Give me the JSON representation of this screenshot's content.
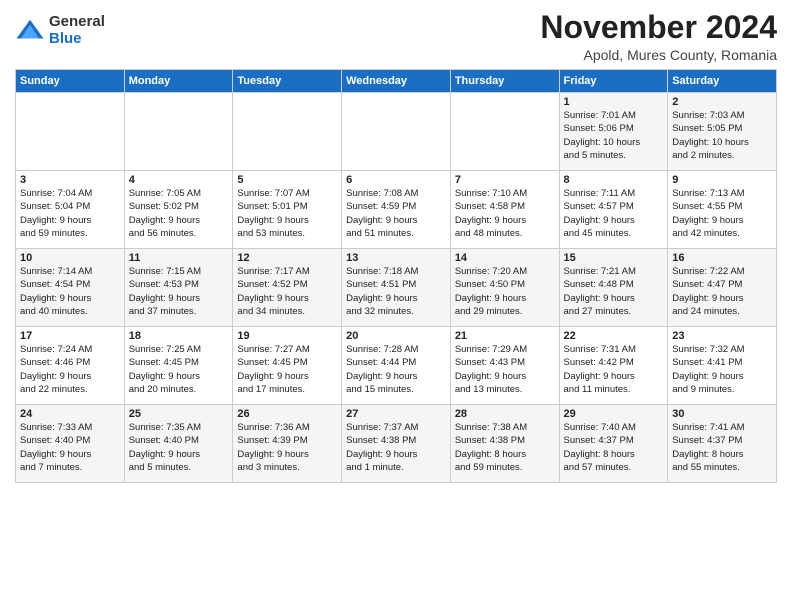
{
  "header": {
    "logo_general": "General",
    "logo_blue": "Blue",
    "title": "November 2024",
    "location": "Apold, Mures County, Romania"
  },
  "weekdays": [
    "Sunday",
    "Monday",
    "Tuesday",
    "Wednesday",
    "Thursday",
    "Friday",
    "Saturday"
  ],
  "weeks": [
    [
      {
        "day": "",
        "info": ""
      },
      {
        "day": "",
        "info": ""
      },
      {
        "day": "",
        "info": ""
      },
      {
        "day": "",
        "info": ""
      },
      {
        "day": "",
        "info": ""
      },
      {
        "day": "1",
        "info": "Sunrise: 7:01 AM\nSunset: 5:06 PM\nDaylight: 10 hours\nand 5 minutes."
      },
      {
        "day": "2",
        "info": "Sunrise: 7:03 AM\nSunset: 5:05 PM\nDaylight: 10 hours\nand 2 minutes."
      }
    ],
    [
      {
        "day": "3",
        "info": "Sunrise: 7:04 AM\nSunset: 5:04 PM\nDaylight: 9 hours\nand 59 minutes."
      },
      {
        "day": "4",
        "info": "Sunrise: 7:05 AM\nSunset: 5:02 PM\nDaylight: 9 hours\nand 56 minutes."
      },
      {
        "day": "5",
        "info": "Sunrise: 7:07 AM\nSunset: 5:01 PM\nDaylight: 9 hours\nand 53 minutes."
      },
      {
        "day": "6",
        "info": "Sunrise: 7:08 AM\nSunset: 4:59 PM\nDaylight: 9 hours\nand 51 minutes."
      },
      {
        "day": "7",
        "info": "Sunrise: 7:10 AM\nSunset: 4:58 PM\nDaylight: 9 hours\nand 48 minutes."
      },
      {
        "day": "8",
        "info": "Sunrise: 7:11 AM\nSunset: 4:57 PM\nDaylight: 9 hours\nand 45 minutes."
      },
      {
        "day": "9",
        "info": "Sunrise: 7:13 AM\nSunset: 4:55 PM\nDaylight: 9 hours\nand 42 minutes."
      }
    ],
    [
      {
        "day": "10",
        "info": "Sunrise: 7:14 AM\nSunset: 4:54 PM\nDaylight: 9 hours\nand 40 minutes."
      },
      {
        "day": "11",
        "info": "Sunrise: 7:15 AM\nSunset: 4:53 PM\nDaylight: 9 hours\nand 37 minutes."
      },
      {
        "day": "12",
        "info": "Sunrise: 7:17 AM\nSunset: 4:52 PM\nDaylight: 9 hours\nand 34 minutes."
      },
      {
        "day": "13",
        "info": "Sunrise: 7:18 AM\nSunset: 4:51 PM\nDaylight: 9 hours\nand 32 minutes."
      },
      {
        "day": "14",
        "info": "Sunrise: 7:20 AM\nSunset: 4:50 PM\nDaylight: 9 hours\nand 29 minutes."
      },
      {
        "day": "15",
        "info": "Sunrise: 7:21 AM\nSunset: 4:48 PM\nDaylight: 9 hours\nand 27 minutes."
      },
      {
        "day": "16",
        "info": "Sunrise: 7:22 AM\nSunset: 4:47 PM\nDaylight: 9 hours\nand 24 minutes."
      }
    ],
    [
      {
        "day": "17",
        "info": "Sunrise: 7:24 AM\nSunset: 4:46 PM\nDaylight: 9 hours\nand 22 minutes."
      },
      {
        "day": "18",
        "info": "Sunrise: 7:25 AM\nSunset: 4:45 PM\nDaylight: 9 hours\nand 20 minutes."
      },
      {
        "day": "19",
        "info": "Sunrise: 7:27 AM\nSunset: 4:45 PM\nDaylight: 9 hours\nand 17 minutes."
      },
      {
        "day": "20",
        "info": "Sunrise: 7:28 AM\nSunset: 4:44 PM\nDaylight: 9 hours\nand 15 minutes."
      },
      {
        "day": "21",
        "info": "Sunrise: 7:29 AM\nSunset: 4:43 PM\nDaylight: 9 hours\nand 13 minutes."
      },
      {
        "day": "22",
        "info": "Sunrise: 7:31 AM\nSunset: 4:42 PM\nDaylight: 9 hours\nand 11 minutes."
      },
      {
        "day": "23",
        "info": "Sunrise: 7:32 AM\nSunset: 4:41 PM\nDaylight: 9 hours\nand 9 minutes."
      }
    ],
    [
      {
        "day": "24",
        "info": "Sunrise: 7:33 AM\nSunset: 4:40 PM\nDaylight: 9 hours\nand 7 minutes."
      },
      {
        "day": "25",
        "info": "Sunrise: 7:35 AM\nSunset: 4:40 PM\nDaylight: 9 hours\nand 5 minutes."
      },
      {
        "day": "26",
        "info": "Sunrise: 7:36 AM\nSunset: 4:39 PM\nDaylight: 9 hours\nand 3 minutes."
      },
      {
        "day": "27",
        "info": "Sunrise: 7:37 AM\nSunset: 4:38 PM\nDaylight: 9 hours\nand 1 minute."
      },
      {
        "day": "28",
        "info": "Sunrise: 7:38 AM\nSunset: 4:38 PM\nDaylight: 8 hours\nand 59 minutes."
      },
      {
        "day": "29",
        "info": "Sunrise: 7:40 AM\nSunset: 4:37 PM\nDaylight: 8 hours\nand 57 minutes."
      },
      {
        "day": "30",
        "info": "Sunrise: 7:41 AM\nSunset: 4:37 PM\nDaylight: 8 hours\nand 55 minutes."
      }
    ]
  ]
}
